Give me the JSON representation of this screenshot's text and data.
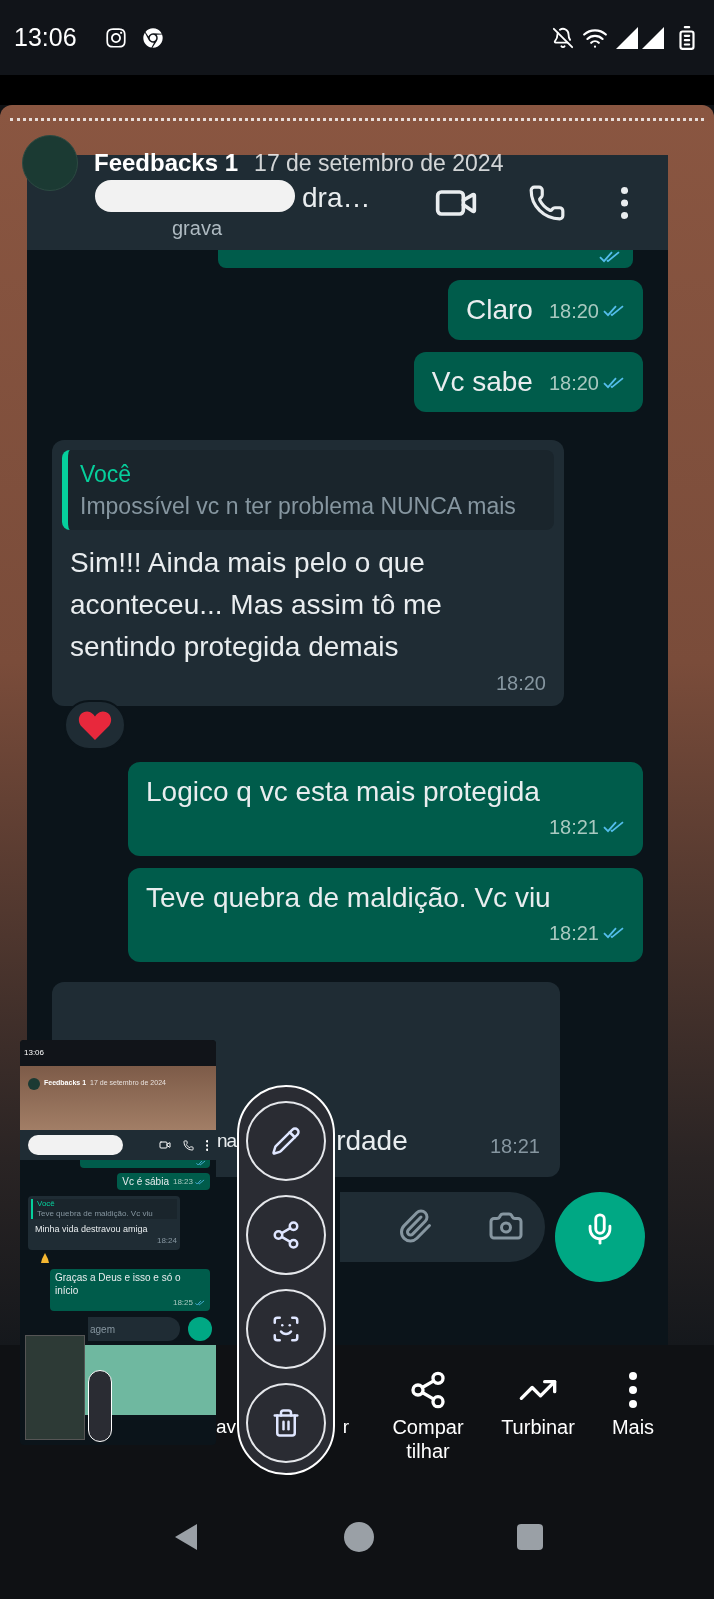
{
  "status_bar": {
    "time": "13:06"
  },
  "story": {
    "title": "Feedbacks 1",
    "date": "17 de setembro de 2024"
  },
  "chat": {
    "header": {
      "title": "dra…",
      "subtitle": "grava"
    },
    "messages": [
      {
        "kind": "sliver",
        "read": true
      },
      {
        "kind": "out",
        "text": "Claro",
        "time": "18:20",
        "read": true
      },
      {
        "kind": "out",
        "text": "Vc sabe",
        "time": "18:20",
        "read": true
      },
      {
        "kind": "in",
        "quote": {
          "author": "Você",
          "text": "Impossível vc n ter problema NUNCA mais"
        },
        "text": "Sim!!! Ainda mais pelo o que aconteceu... Mas assim tô me sentindo protegida demais",
        "time": "18:20",
        "reaction": {
          "kind": "heart"
        }
      },
      {
        "kind": "out",
        "text": "Logico q vc esta mais protegida",
        "time": "18:21",
        "read": true
      },
      {
        "kind": "out",
        "text": "Teve quebra de maldição. Vc viu",
        "time": "18:21",
        "read": true
      },
      {
        "kind": "partial",
        "fragments": [
          "na",
          "rdade"
        ],
        "time": "18:21"
      }
    ]
  },
  "thumbnail": {
    "time": "13:06",
    "title": "Feedbacks 1",
    "date": "17 de setembro de 2024",
    "messages": [
      {
        "kind": "sliver",
        "read": true
      },
      {
        "kind": "out",
        "text": "Vc é sábia",
        "time": "18:23",
        "read": true
      },
      {
        "kind": "in",
        "quote": {
          "author": "Você",
          "text": "Teve quebra de maldição. Vc viu"
        },
        "text": "Minha vida destravou amiga",
        "time": "18:24",
        "reaction": {
          "kind": "pray"
        }
      },
      {
        "kind": "out",
        "text": "Graças a Deus e isso e só o início",
        "time": "18:25",
        "read": true
      }
    ],
    "input": {
      "placeholder": "agem"
    }
  },
  "toolbar": [
    {
      "kind": "edit"
    },
    {
      "kind": "share"
    },
    {
      "kind": "scan"
    },
    {
      "kind": "delete"
    }
  ],
  "actions": [
    {
      "kind": "label",
      "lines": [
        "av"
      ]
    },
    {
      "kind": "label",
      "lines": [
        "r"
      ]
    },
    {
      "kind": "share",
      "lines": [
        "Compar",
        "tilhar"
      ]
    },
    {
      "kind": "boost",
      "lines": [
        "Turbinar"
      ]
    },
    {
      "kind": "more",
      "lines": [
        "Mais"
      ]
    }
  ]
}
